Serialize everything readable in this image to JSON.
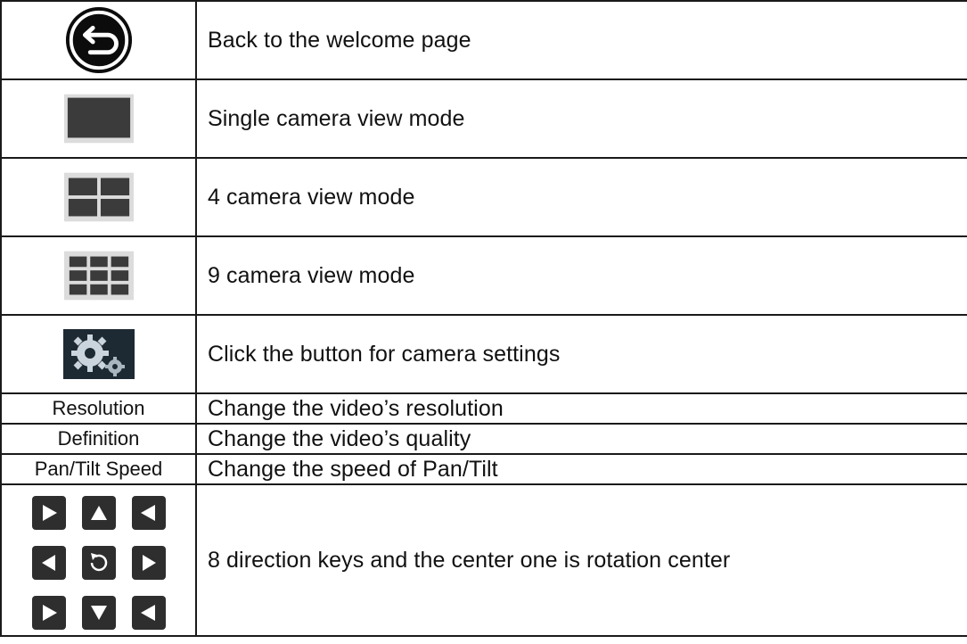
{
  "rows": [
    {
      "icon": "back-arrow-icon",
      "description": "Back to the welcome page"
    },
    {
      "icon": "single-view-icon",
      "description": "Single camera view mode"
    },
    {
      "icon": "quad-view-icon",
      "description": "4 camera view mode"
    },
    {
      "icon": "nine-view-icon",
      "description": "9 camera view mode"
    },
    {
      "icon": "settings-gear-icon",
      "description": "Click the button for camera settings"
    },
    {
      "label": "Resolution",
      "description": "Change the video’s resolution"
    },
    {
      "label": "Definition",
      "description": "Change the video’s quality"
    },
    {
      "label": "Pan/Tilt Speed",
      "description": "Change the speed of Pan/Tilt"
    },
    {
      "icon": "direction-pad-icon",
      "description": "8 direction keys and the center one is rotation center"
    }
  ],
  "colors": {
    "border": "#1a1a1a",
    "tile_dark": "#3a3a3a",
    "tile_bg": "#d9d9d9",
    "key_dark": "#2e2e2e"
  }
}
